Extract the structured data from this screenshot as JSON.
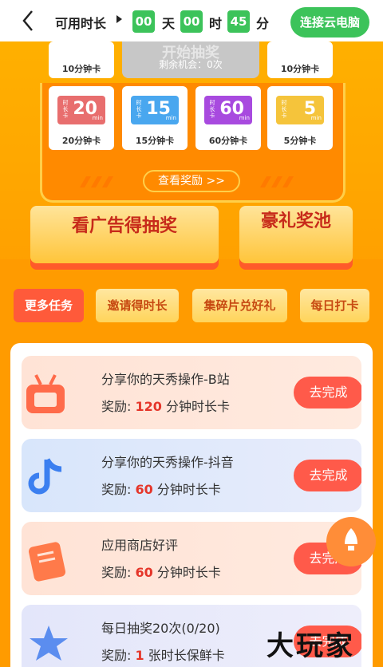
{
  "header": {
    "label": "可用时长",
    "days": "00",
    "days_unit": "天",
    "hours": "00",
    "hours_unit": "时",
    "minutes": "45",
    "minutes_unit": "分",
    "connect_label": "连接云电脑"
  },
  "machine": {
    "center_title": "开始抽奖",
    "center_sub": "剩余机会：0次",
    "top_cards": [
      "10分钟卡",
      "10分钟卡"
    ],
    "cards": [
      {
        "label": "20分钟卡",
        "value": "20",
        "color": "#e86e6e"
      },
      {
        "label": "15分钟卡",
        "value": "15",
        "color": "#49a7ef"
      },
      {
        "label": "60分钟卡",
        "value": "60",
        "color": "#a84adf"
      },
      {
        "label": "5分钟卡",
        "value": "5",
        "color": "#f5c43b"
      }
    ],
    "ticket_word": "时长卡",
    "unit": "min",
    "view_rewards": "查看奖励 >>",
    "ad_button": "看广告得抽奖",
    "pool_button": "豪礼奖池"
  },
  "tabs": [
    "更多任务",
    "邀请得时长",
    "集碎片兑好礼",
    "每日打卡"
  ],
  "tasks": [
    {
      "title": "分享你的天秀操作-B站",
      "reward_prefix": "奖励: ",
      "reward_value": "120",
      "reward_suffix": " 分钟时长卡",
      "action": "去完成",
      "bg": "#ffe1d3",
      "icon": "bilibili-icon"
    },
    {
      "title": "分享你的天秀操作-抖音",
      "reward_prefix": "奖励: ",
      "reward_value": "60",
      "reward_suffix": " 分钟时长卡",
      "action": "去完成",
      "bg": "#dde7fb",
      "icon": "douyin-icon"
    },
    {
      "title": "应用商店好评",
      "reward_prefix": "奖励: ",
      "reward_value": "60",
      "reward_suffix": " 分钟时长卡",
      "action": "去完成",
      "bg": "#ffe1d3",
      "icon": "review-icon"
    },
    {
      "title": "每日抽奖20次(0/20)",
      "reward_prefix": "奖励: ",
      "reward_value": "1",
      "reward_suffix": " 张时长保鲜卡",
      "action": "去完成",
      "bg": "#e6e6f8",
      "icon": "prize-icon"
    }
  ],
  "watermark": "大玩家"
}
